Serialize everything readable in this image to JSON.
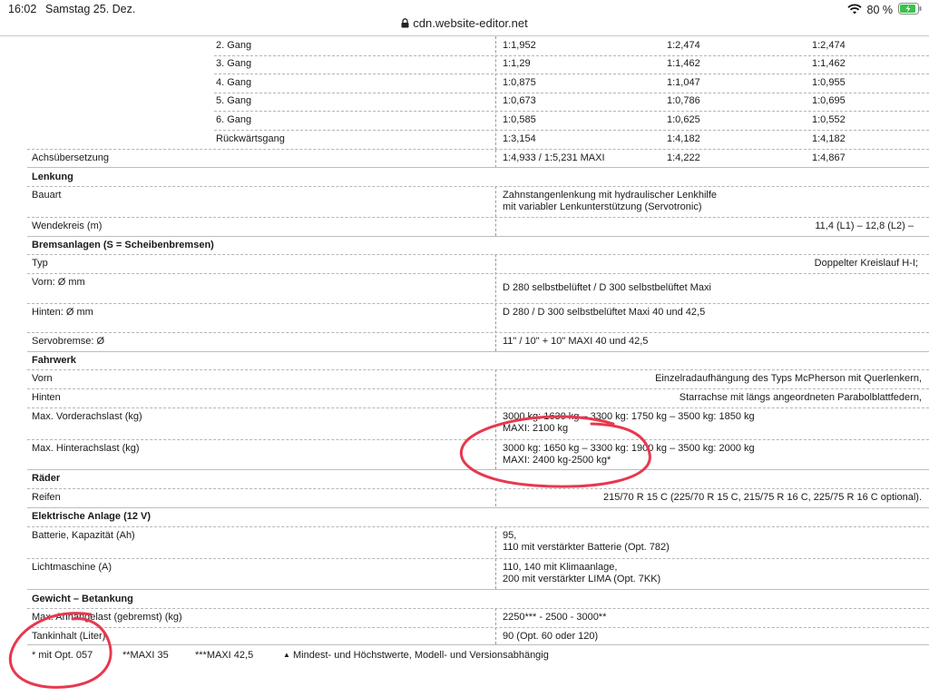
{
  "status_bar": {
    "time": "16:02",
    "date": "Samstag 25. Dez.",
    "battery": "80 %"
  },
  "browser": {
    "url": "cdn.website-editor.net"
  },
  "colors": {
    "annotation": "#e8384f",
    "battery_fill": "#3ac24a"
  },
  "table": {
    "gear_rows": [
      {
        "label": "2. Gang",
        "v1": "1:1,952",
        "v2": "1:2,474",
        "v3": "1:2,474"
      },
      {
        "label": "3. Gang",
        "v1": "1:1,29",
        "v2": "1:1,462",
        "v3": "1:1,462"
      },
      {
        "label": "4. Gang",
        "v1": "1:0,875",
        "v2": "1:1,047",
        "v3": "1:0,955"
      },
      {
        "label": "5. Gang",
        "v1": "1:0,673",
        "v2": "1:0,786",
        "v3": "1:0,695"
      },
      {
        "label": "6. Gang",
        "v1": "1:0,585",
        "v2": "1:0,625",
        "v3": "1:0,552"
      },
      {
        "label": "Rückwärtsgang",
        "v1": "1:3,154",
        "v2": "1:4,182",
        "v3": "1:4,182"
      }
    ],
    "achse": {
      "label": "Achsübersetzung",
      "v1": "1:4,933 / 1:5,231 MAXI",
      "v2": "1:4,222",
      "v3": "1:4,867"
    },
    "lenkung": {
      "title": "Lenkung",
      "bauart_label": "Bauart",
      "bauart_value_1": "Zahnstangenlenkung mit hydraulischer Lenkhilfe",
      "bauart_value_2": "mit variabler Lenkunterstützung (Servotronic)",
      "wende_label": "Wendekreis (m)",
      "wende_value": "11,4 (L1) – 12,8 (L2) –"
    },
    "bremsen": {
      "title": "Bremsanlagen (S = Scheibenbremsen)",
      "typ_label": "Typ",
      "typ_value": "Doppelter Kreislauf H-I;",
      "vorn_label": "Vorn: Ø mm",
      "vorn_value": "D 280 selbstbelüftet / D 300 selbstbelüftet Maxi",
      "hinten_label": "Hinten: Ø mm",
      "hinten_value": "D 280 / D 300 selbstbelüftet Maxi 40 und 42,5",
      "servo_label": "Servobremse: Ø",
      "servo_value": "11\" / 10\" + 10\" MAXI 40 und 42,5"
    },
    "fahrwerk": {
      "title": "Fahrwerk",
      "vorn_label": "Vorn",
      "vorn_value": "Einzelradaufhängung des Typs McPherson mit Querlenkern,",
      "hinten_label": "Hinten",
      "hinten_value": "Starrachse mit längs angeordneten Parabolblattfedern,",
      "vorder_label": "Max. Vorderachslast (kg)",
      "vorder_value_1": "3000 kg: 1630 kg – 3300 kg: 1750 kg – 3500 kg: 1850 kg",
      "vorder_value_2": "MAXI: 2100 kg",
      "hinter_label": "Max. Hinterachslast (kg)",
      "hinter_value_1": "3000 kg: 1650 kg – 3300 kg: 1900 kg – 3500 kg: 2000 kg",
      "hinter_value_2": "MAXI: 2400 kg-2500 kg*"
    },
    "raeder": {
      "title": "Räder",
      "reifen_label": "Reifen",
      "reifen_value": "215/70 R 15 C  (225/70 R 15 C, 215/75 R 16 C, 225/75 R 16 C optional)."
    },
    "elektrik": {
      "title": "Elektrische Anlage (12 V)",
      "batt_label": "Batterie, Kapazität (Ah)",
      "batt_value_1": "95,",
      "batt_value_2": "110 mit verstärkter Batterie (Opt. 782)",
      "lima_label": "Lichtmaschine (A)",
      "lima_value_1": "110, 140 mit Klimaanlage,",
      "lima_value_2": "200 mit verstärkter LIMA (Opt. 7KK)"
    },
    "gewicht": {
      "title": "Gewicht – Betankung",
      "anh_label": "Max. Anhängelast (gebremst) (kg)",
      "anh_value": "2250*** - 2500 - 3000**",
      "tank_label": "Tankinhalt (Liter)",
      "tank_value": "90 (Opt. 60 oder 120)"
    }
  },
  "footnotes": {
    "f1": "* mit Opt. 057",
    "f2": "**MAXI 35",
    "f3": "***MAXI  42,5",
    "f4": "Mindest- und Höchstwerte, Modell- und Versionsabhängig"
  }
}
